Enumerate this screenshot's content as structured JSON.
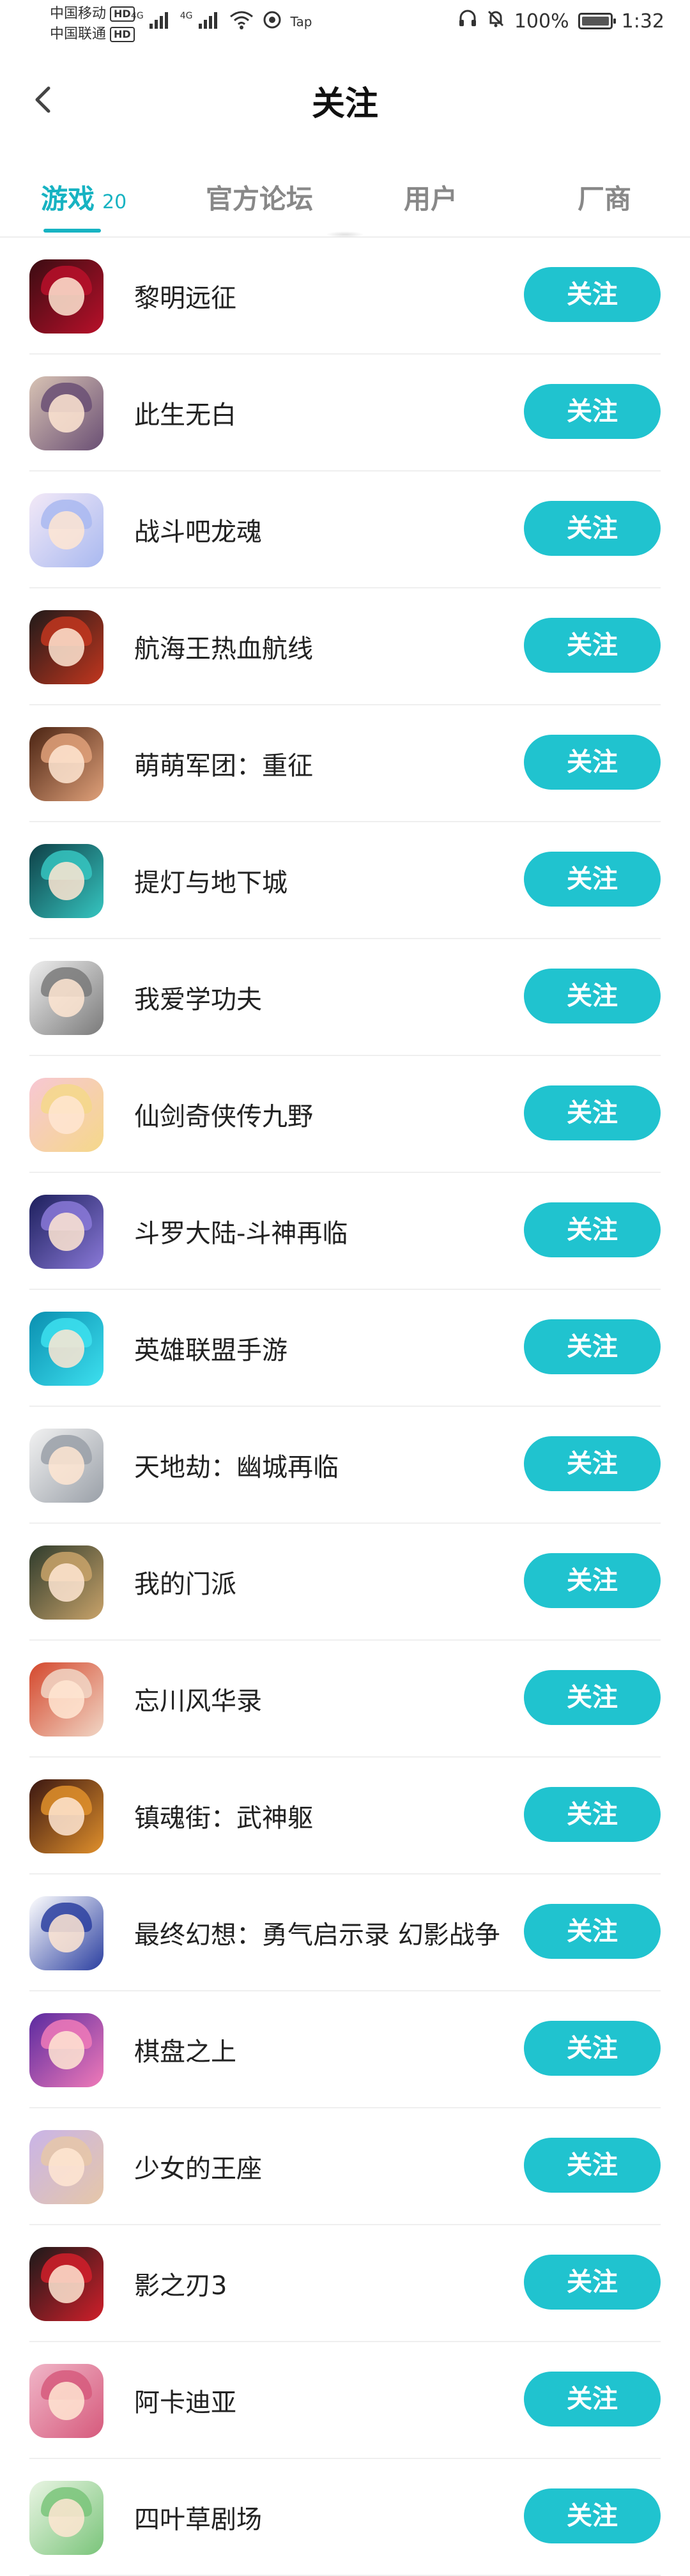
{
  "status_bar": {
    "carrier1": "中国移动",
    "carrier2": "中国联通",
    "hd": "HD",
    "net1": "4G",
    "net2": "4G",
    "tap_label": "Tap",
    "battery": "100%",
    "time": "1:32"
  },
  "header": {
    "title": "关注",
    "back_icon": "chevron-left-icon"
  },
  "tabs": [
    {
      "label": "游戏",
      "count": "20",
      "active": true
    },
    {
      "label": "官方论坛",
      "active": false
    },
    {
      "label": "用户",
      "active": false
    },
    {
      "label": "厂商",
      "active": false
    }
  ],
  "colors": {
    "accent": "#17b3c2",
    "button": "#20c3cf"
  },
  "games": [
    {
      "name": "黎明远征",
      "button": "关注",
      "colors": [
        "#3a0c12",
        "#b8102a"
      ]
    },
    {
      "name": "此生无白",
      "button": "关注",
      "colors": [
        "#d8c3b4",
        "#6a4f74"
      ]
    },
    {
      "name": "战斗吧龙魂",
      "button": "关注",
      "colors": [
        "#f3e9f7",
        "#a9b9f0"
      ]
    },
    {
      "name": "航海王热血航线",
      "button": "关注",
      "colors": [
        "#1f1a1a",
        "#c2361e"
      ]
    },
    {
      "name": "萌萌军团：重征",
      "button": "关注",
      "colors": [
        "#4a2312",
        "#e0a17a"
      ]
    },
    {
      "name": "提灯与地下城",
      "button": "关注",
      "colors": [
        "#0e3f46",
        "#36c6c1"
      ]
    },
    {
      "name": "我爱学功夫",
      "button": "关注",
      "colors": [
        "#efefef",
        "#7a7a7a"
      ]
    },
    {
      "name": "仙剑奇侠传九野",
      "button": "关注",
      "colors": [
        "#f7c7d4",
        "#f5d889"
      ]
    },
    {
      "name": "斗罗大陆-斗神再临",
      "button": "关注",
      "colors": [
        "#1c1f5c",
        "#8a79d8"
      ]
    },
    {
      "name": "英雄联盟手游",
      "button": "关注",
      "colors": [
        "#0a8fb0",
        "#3de0ef"
      ]
    },
    {
      "name": "天地劫：幽城再临",
      "button": "关注",
      "colors": [
        "#f2f2f2",
        "#9aa0a8"
      ]
    },
    {
      "name": "我的门派",
      "button": "关注",
      "colors": [
        "#2e3b2c",
        "#c9a36a"
      ]
    },
    {
      "name": "忘川风华录",
      "button": "关注",
      "colors": [
        "#d4472c",
        "#f1d6c5"
      ]
    },
    {
      "name": "镇魂街：武神躯",
      "button": "关注",
      "colors": [
        "#3a1611",
        "#e0902c"
      ]
    },
    {
      "name": "最终幻想：勇气启示录 幻影战争",
      "button": "关注",
      "colors": [
        "#ffffff",
        "#2b3fa0"
      ]
    },
    {
      "name": "棋盘之上",
      "button": "关注",
      "colors": [
        "#5a2aa0",
        "#f07ab8"
      ]
    },
    {
      "name": "少女的王座",
      "button": "关注",
      "colors": [
        "#c9b4e8",
        "#e6c7a8"
      ]
    },
    {
      "name": "影之刃3",
      "button": "关注",
      "colors": [
        "#1a1a1a",
        "#d11f2a"
      ]
    },
    {
      "name": "阿卡迪亚",
      "button": "关注",
      "colors": [
        "#f0b6c8",
        "#d65a7c"
      ]
    },
    {
      "name": "四叶草剧场",
      "button": "关注",
      "colors": [
        "#eaf5e4",
        "#7ac47a"
      ]
    }
  ]
}
